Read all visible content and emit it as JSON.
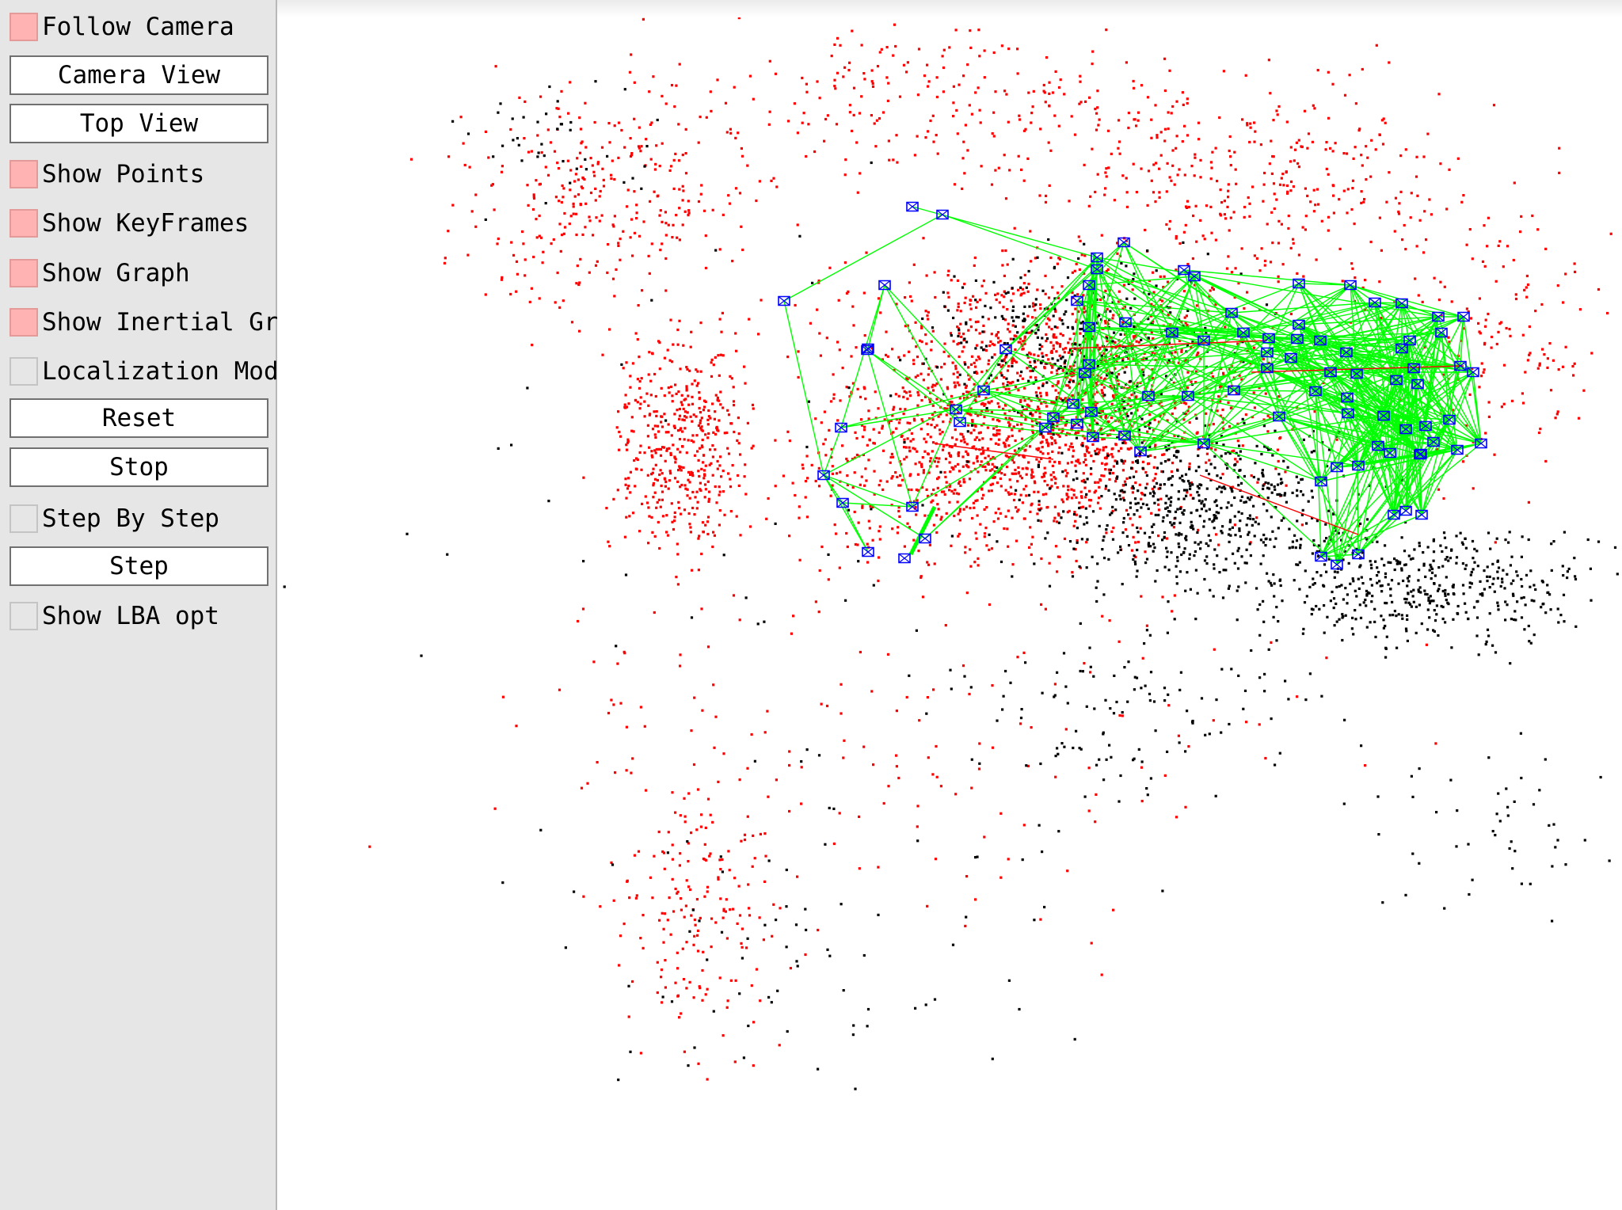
{
  "panel": {
    "follow_camera": {
      "label": "Follow Camera",
      "checked": true
    },
    "camera_view": {
      "label": "Camera View"
    },
    "top_view": {
      "label": "Top View"
    },
    "show_points": {
      "label": "Show Points",
      "checked": true
    },
    "show_keyframes": {
      "label": "Show KeyFrames",
      "checked": true
    },
    "show_graph": {
      "label": "Show Graph",
      "checked": true
    },
    "show_inertial_graph": {
      "label": "Show Inertial Graph",
      "checked": true
    },
    "localization_mode": {
      "label": "Localization Mode",
      "checked": false
    },
    "reset": {
      "label": "Reset"
    },
    "stop": {
      "label": "Stop"
    },
    "step_by_step": {
      "label": "Step By Step",
      "checked": false
    },
    "step": {
      "label": "Step"
    },
    "show_lba_opt": {
      "label": "Show LBA opt",
      "checked": false
    }
  },
  "colors": {
    "panel_bg": "#e6e6e6",
    "checkbox_on": "#ffb3b3",
    "map_point_reference": "#ff0000",
    "map_point": "#000000",
    "keyframe": "#0000ff",
    "covisibility_graph": "#00ff00",
    "inertial_graph": "#ff0000"
  }
}
